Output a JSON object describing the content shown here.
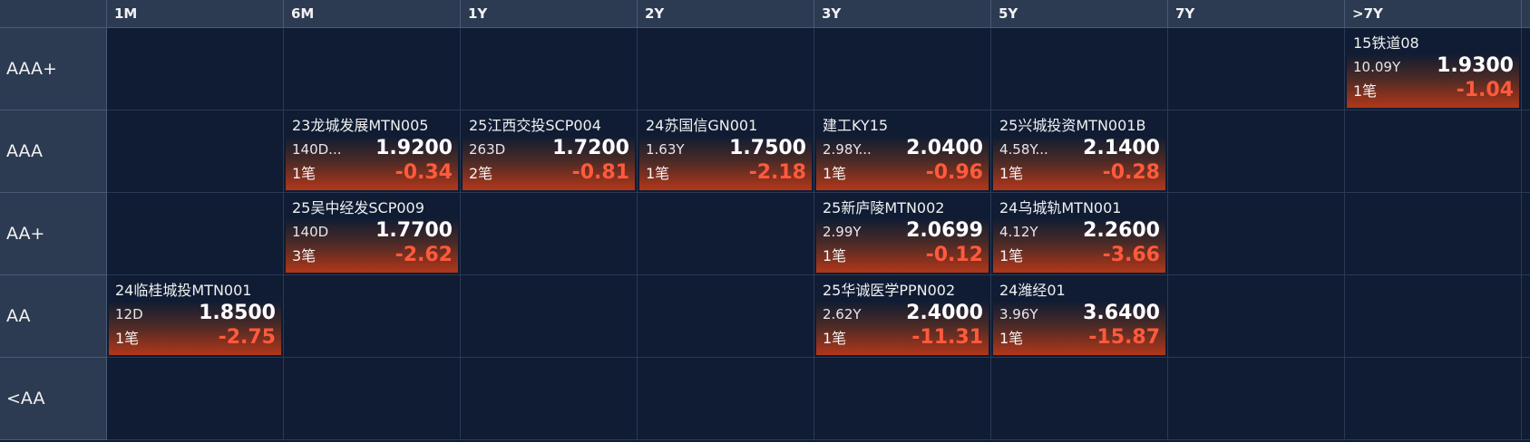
{
  "columns": [
    "1M",
    "6M",
    "1Y",
    "2Y",
    "3Y",
    "5Y",
    "7Y",
    ">7Y"
  ],
  "rows": [
    "AAA+",
    "AAA",
    "AA+",
    "AA",
    "<AA"
  ],
  "colors": {
    "up": "#ff5a3c",
    "header_bg": "#2c3b52",
    "cell_bg": "#0f1c33"
  },
  "cards": [
    {
      "row": 0,
      "col": 7,
      "name": "15铁道08",
      "term": "10.09Y",
      "yield": "1.9300",
      "count": "1笔",
      "change": "-1.04"
    },
    {
      "row": 1,
      "col": 1,
      "name": "23龙城发展MTN005",
      "term": "140D...",
      "yield": "1.9200",
      "count": "1笔",
      "change": "-0.34"
    },
    {
      "row": 1,
      "col": 2,
      "name": "25江西交投SCP004",
      "term": "263D",
      "yield": "1.7200",
      "count": "2笔",
      "change": "-0.81"
    },
    {
      "row": 1,
      "col": 3,
      "name": "24苏国信GN001",
      "term": "1.63Y",
      "yield": "1.7500",
      "count": "1笔",
      "change": "-2.18"
    },
    {
      "row": 1,
      "col": 4,
      "name": "建工KY15",
      "term": "2.98Y...",
      "yield": "2.0400",
      "count": "1笔",
      "change": "-0.96"
    },
    {
      "row": 1,
      "col": 5,
      "name": "25兴城投资MTN001B",
      "term": "4.58Y...",
      "yield": "2.1400",
      "count": "1笔",
      "change": "-0.28"
    },
    {
      "row": 2,
      "col": 1,
      "name": "25吴中经发SCP009",
      "term": "140D",
      "yield": "1.7700",
      "count": "3笔",
      "change": "-2.62"
    },
    {
      "row": 2,
      "col": 4,
      "name": "25新庐陵MTN002",
      "term": "2.99Y",
      "yield": "2.0699",
      "count": "1笔",
      "change": "-0.12"
    },
    {
      "row": 2,
      "col": 5,
      "name": "24乌城轨MTN001",
      "term": "4.12Y",
      "yield": "2.2600",
      "count": "1笔",
      "change": "-3.66"
    },
    {
      "row": 3,
      "col": 0,
      "name": "24临桂城投MTN001",
      "term": "12D",
      "yield": "1.8500",
      "count": "1笔",
      "change": "-2.75"
    },
    {
      "row": 3,
      "col": 4,
      "name": "25华诚医学PPN002",
      "term": "2.62Y",
      "yield": "2.4000",
      "count": "1笔",
      "change": "-11.31"
    },
    {
      "row": 3,
      "col": 5,
      "name": "24潍经01",
      "term": "3.96Y",
      "yield": "3.6400",
      "count": "1笔",
      "change": "-15.87"
    }
  ]
}
